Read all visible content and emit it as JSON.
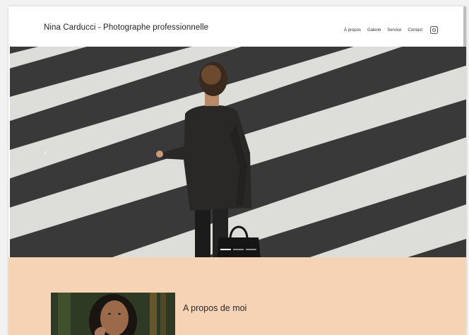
{
  "header": {
    "site_title": "Nina Carducci - Photographe professionnelle",
    "nav": [
      {
        "label": "À propos"
      },
      {
        "label": "Galerie"
      },
      {
        "label": "Service"
      },
      {
        "label": "Contact"
      }
    ],
    "social_icon": "instagram-icon"
  },
  "hero": {
    "image": "businessman-crossing-zebra-crosswalk",
    "slide_count": 3,
    "active_slide": 1
  },
  "about": {
    "title": "A propos de moi",
    "portrait": "woman-portrait-photo"
  },
  "colors": {
    "about_background": "#f7d3b5",
    "page_background": "#ffffff"
  }
}
